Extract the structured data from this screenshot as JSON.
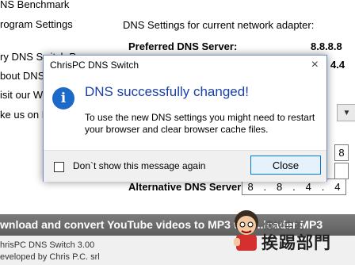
{
  "left_menu": {
    "items": [
      {
        "label": "NS Benchmark"
      },
      {
        "label": "rogram Settings"
      },
      {
        "label": "ry DNS Switch Pro"
      },
      {
        "label": "bout DNS"
      },
      {
        "label": "isit our We"
      },
      {
        "label": "ke us on F"
      }
    ]
  },
  "dns_panel": {
    "heading": "DNS Settings for current network adapter:",
    "preferred_label": "Preferred DNS Server:",
    "preferred_value": "8.8.8.8",
    "secondary_partial": "4.4",
    "alternative_label": "Alternative DNS Server:",
    "alternative_octets": [
      "8",
      "8",
      "4",
      "4"
    ],
    "partial_box_value": "8",
    "dropdown_icon": "chevron-down-icon"
  },
  "dialog": {
    "title": "ChrisPC DNS Switch",
    "close_glyph": "×",
    "icon": "info-icon",
    "heading": "DNS successfully changed!",
    "message": "To use the new DNS settings you might need to restart your browser and clear browser cache files.",
    "checkbox_label": "Don`t show this message again",
    "checkbox_checked": false,
    "close_button": "Close"
  },
  "banner": {
    "text": "wnload and convert YouTube videos to MP3 w... ...loader MP3"
  },
  "footer": {
    "version": "hrisPC DNS Switch 3.00",
    "developer": "eveloped by Chris P.C. srl"
  },
  "watermark": {
    "line1": "傳說中的",
    "line2": "挨踢部門"
  },
  "colors": {
    "dialog_heading": "#1a3fa8",
    "info_icon": "#1b6ac9",
    "dialog_border": "#6c8fbf",
    "banner_bg": "#6b6b6b",
    "button_border": "#0078d7"
  }
}
